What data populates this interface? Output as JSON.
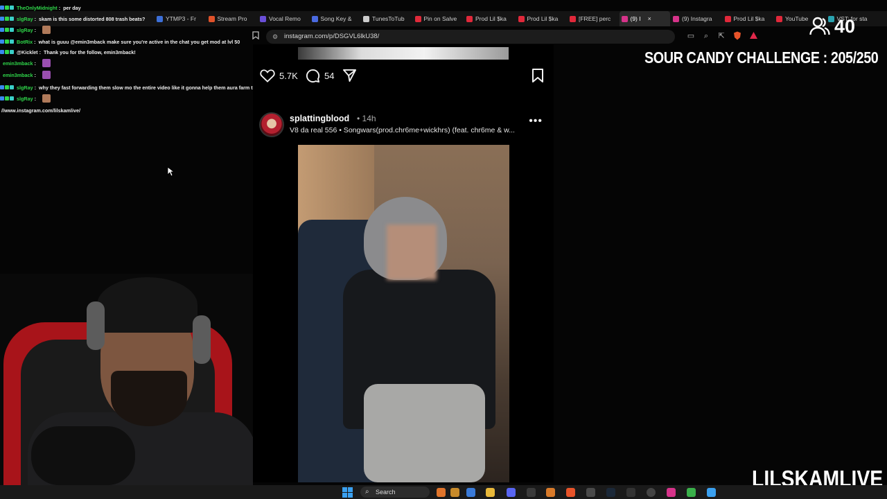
{
  "browser": {
    "tabs": [
      {
        "label": "YTMP3 - Fr",
        "color": "#3c6fd8"
      },
      {
        "label": "Stream Pro",
        "color": "#e0522a"
      },
      {
        "label": "Vocal Remo",
        "color": "#6a4fd8"
      },
      {
        "label": "Song Key &",
        "color": "#4a6ae0"
      },
      {
        "label": "TunesToTub",
        "color": "#cccccc"
      },
      {
        "label": "Pin on Salve",
        "color": "#e02a3a"
      },
      {
        "label": "Prod Lil $ka",
        "color": "#e0283a"
      },
      {
        "label": "Prod Lil $ka",
        "color": "#e0283a"
      },
      {
        "label": "[FREE] perc",
        "color": "#e0283a"
      },
      {
        "label": "(9) I",
        "color": "#d6338a",
        "active": true
      },
      {
        "label": "(9) Instagra",
        "color": "#d6338a"
      },
      {
        "label": "Prod Lil $ka",
        "color": "#e0283a"
      },
      {
        "label": "YouTube",
        "color": "#e0283a"
      },
      {
        "label": "VST: for sta",
        "color": "#2aa3b0"
      }
    ],
    "url": "instagram.com/p/DSGVL6lkU38/"
  },
  "chat": [
    {
      "user": "TheOnlyMidnight",
      "color": "#2fd64a",
      "message": "per day"
    },
    {
      "user": "slgRay",
      "color": "#2fd64a",
      "message": "skam is this some distorted 808 trash beats?"
    },
    {
      "user": "slgRay",
      "color": "#2fd64a",
      "message": "",
      "emote": "#b07a5a"
    },
    {
      "user": "BotRix",
      "color": "#2fd64a",
      "message": "what is guuu @emin3mback make sure you're active in the chat you get mod at lvl 50"
    },
    {
      "user": "@Kicklet",
      "color": "#e8e8e8",
      "message": "Thank you for the follow, emin3mback!"
    },
    {
      "user": "emin3mback",
      "color": "#2fd64a",
      "message": "",
      "emote": "#9a4fb0"
    },
    {
      "user": "emin3mback",
      "color": "#2fd64a",
      "message": "",
      "emote": "#9a4fb0"
    },
    {
      "user": "slgRay",
      "color": "#2fd64a",
      "message": "why they fast forwarding them slow mo the entire video like it gonna help them aura farm tho"
    },
    {
      "user": "slgRay",
      "color": "#2fd64a",
      "message": "",
      "emote": "#b07a5a"
    },
    {
      "user": "",
      "color": "#e8e8e8",
      "message": "//www.instagram.com/lilskamlive/"
    }
  ],
  "post_actions": {
    "likes": "5.7K",
    "comments": "54"
  },
  "post": {
    "username": "splattingblood",
    "age": "• 14h",
    "audio": "V8 da real 556 • Songwars(prod.chr6me+wickhrs) (feat. chr6me & w..."
  },
  "overlay": {
    "viewer_count": "40",
    "challenge": "SOUR CANDY CHALLENGE : 205/250",
    "streamer": "LILSKAMLIVE"
  },
  "taskbar": {
    "search_label": "Search"
  }
}
